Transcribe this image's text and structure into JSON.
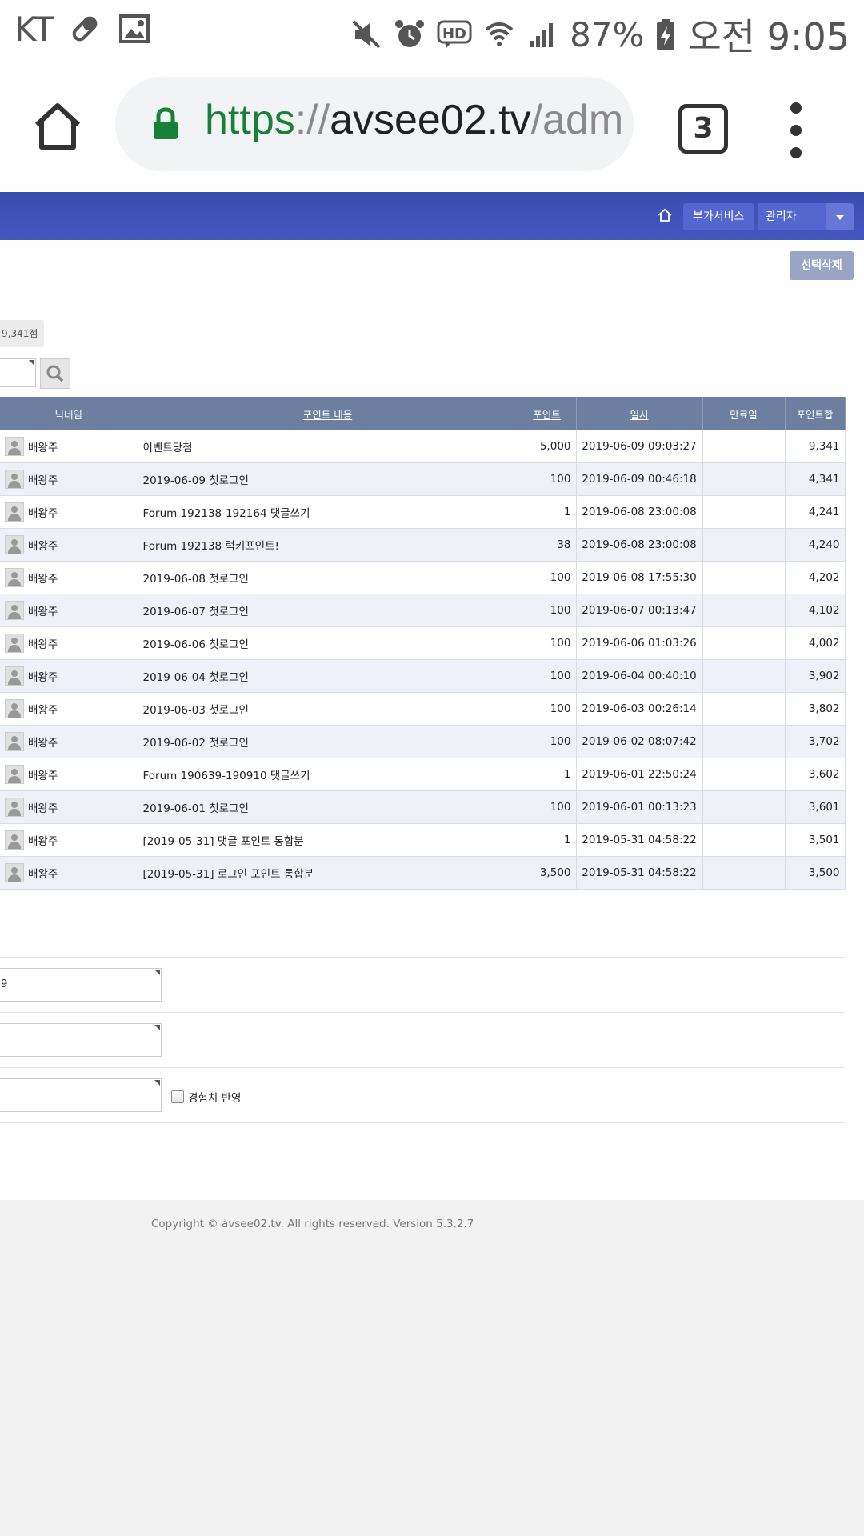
{
  "status_bar": {
    "carrier": "KT",
    "battery": "87%",
    "time": "오전 9:05"
  },
  "browser": {
    "url_scheme": "https",
    "url_sep": "://",
    "url_host": "avsee02.tv",
    "url_path": "/adm",
    "tab_count": "3"
  },
  "nav": {
    "extra_service": "부가서비스",
    "admin": "관리자"
  },
  "toolbar": {
    "delete_selected": "선택삭제"
  },
  "summary": {
    "total_points": "9,341점"
  },
  "table": {
    "headers": {
      "nickname": "닉네임",
      "content": "포인트 내용",
      "point": "포인트",
      "datetime": "일시",
      "expire": "만료일",
      "total": "포인트합"
    },
    "rows": [
      {
        "nick": "배왕주",
        "content": "이벤트당첨",
        "point": "5,000",
        "datetime": "2019-06-09 09:03:27",
        "expire": "",
        "total": "9,341"
      },
      {
        "nick": "배왕주",
        "content": "2019-06-09 첫로그인",
        "point": "100",
        "datetime": "2019-06-09 00:46:18",
        "expire": "",
        "total": "4,341"
      },
      {
        "nick": "배왕주",
        "content": "Forum 192138-192164 댓글쓰기",
        "point": "1",
        "datetime": "2019-06-08 23:00:08",
        "expire": "",
        "total": "4,241"
      },
      {
        "nick": "배왕주",
        "content": "Forum 192138 럭키포인트!",
        "point": "38",
        "datetime": "2019-06-08 23:00:08",
        "expire": "",
        "total": "4,240"
      },
      {
        "nick": "배왕주",
        "content": "2019-06-08 첫로그인",
        "point": "100",
        "datetime": "2019-06-08 17:55:30",
        "expire": "",
        "total": "4,202"
      },
      {
        "nick": "배왕주",
        "content": "2019-06-07 첫로그인",
        "point": "100",
        "datetime": "2019-06-07 00:13:47",
        "expire": "",
        "total": "4,102"
      },
      {
        "nick": "배왕주",
        "content": "2019-06-06 첫로그인",
        "point": "100",
        "datetime": "2019-06-06 01:03:26",
        "expire": "",
        "total": "4,002"
      },
      {
        "nick": "배왕주",
        "content": "2019-06-04 첫로그인",
        "point": "100",
        "datetime": "2019-06-04 00:40:10",
        "expire": "",
        "total": "3,902"
      },
      {
        "nick": "배왕주",
        "content": "2019-06-03 첫로그인",
        "point": "100",
        "datetime": "2019-06-03 00:26:14",
        "expire": "",
        "total": "3,802"
      },
      {
        "nick": "배왕주",
        "content": "2019-06-02 첫로그인",
        "point": "100",
        "datetime": "2019-06-02 08:07:42",
        "expire": "",
        "total": "3,702"
      },
      {
        "nick": "배왕주",
        "content": "Forum 190639-190910 댓글쓰기",
        "point": "1",
        "datetime": "2019-06-01 22:50:24",
        "expire": "",
        "total": "3,602"
      },
      {
        "nick": "배왕주",
        "content": "2019-06-01 첫로그인",
        "point": "100",
        "datetime": "2019-06-01 00:13:23",
        "expire": "",
        "total": "3,601"
      },
      {
        "nick": "배왕주",
        "content": "[2019-05-31] 댓글 포인트 통합분",
        "point": "1",
        "datetime": "2019-05-31 04:58:22",
        "expire": "",
        "total": "3,501"
      },
      {
        "nick": "배왕주",
        "content": "[2019-05-31] 로그인 포인트 통합분",
        "point": "3,500",
        "datetime": "2019-05-31 04:58:22",
        "expire": "",
        "total": "3,500"
      }
    ]
  },
  "form": {
    "field1_value": "9",
    "field2_value": "",
    "field3_value": "",
    "exp_label": "경험치 반영"
  },
  "footer": {
    "copyright": "Copyright © avsee02.tv. All rights reserved. Version 5.3.2.7"
  },
  "colors": {
    "nav_bg": "#3f51b5",
    "table_header": "#6d7fa1",
    "row_alt": "#eef1f8",
    "url_secure": "#188038"
  }
}
